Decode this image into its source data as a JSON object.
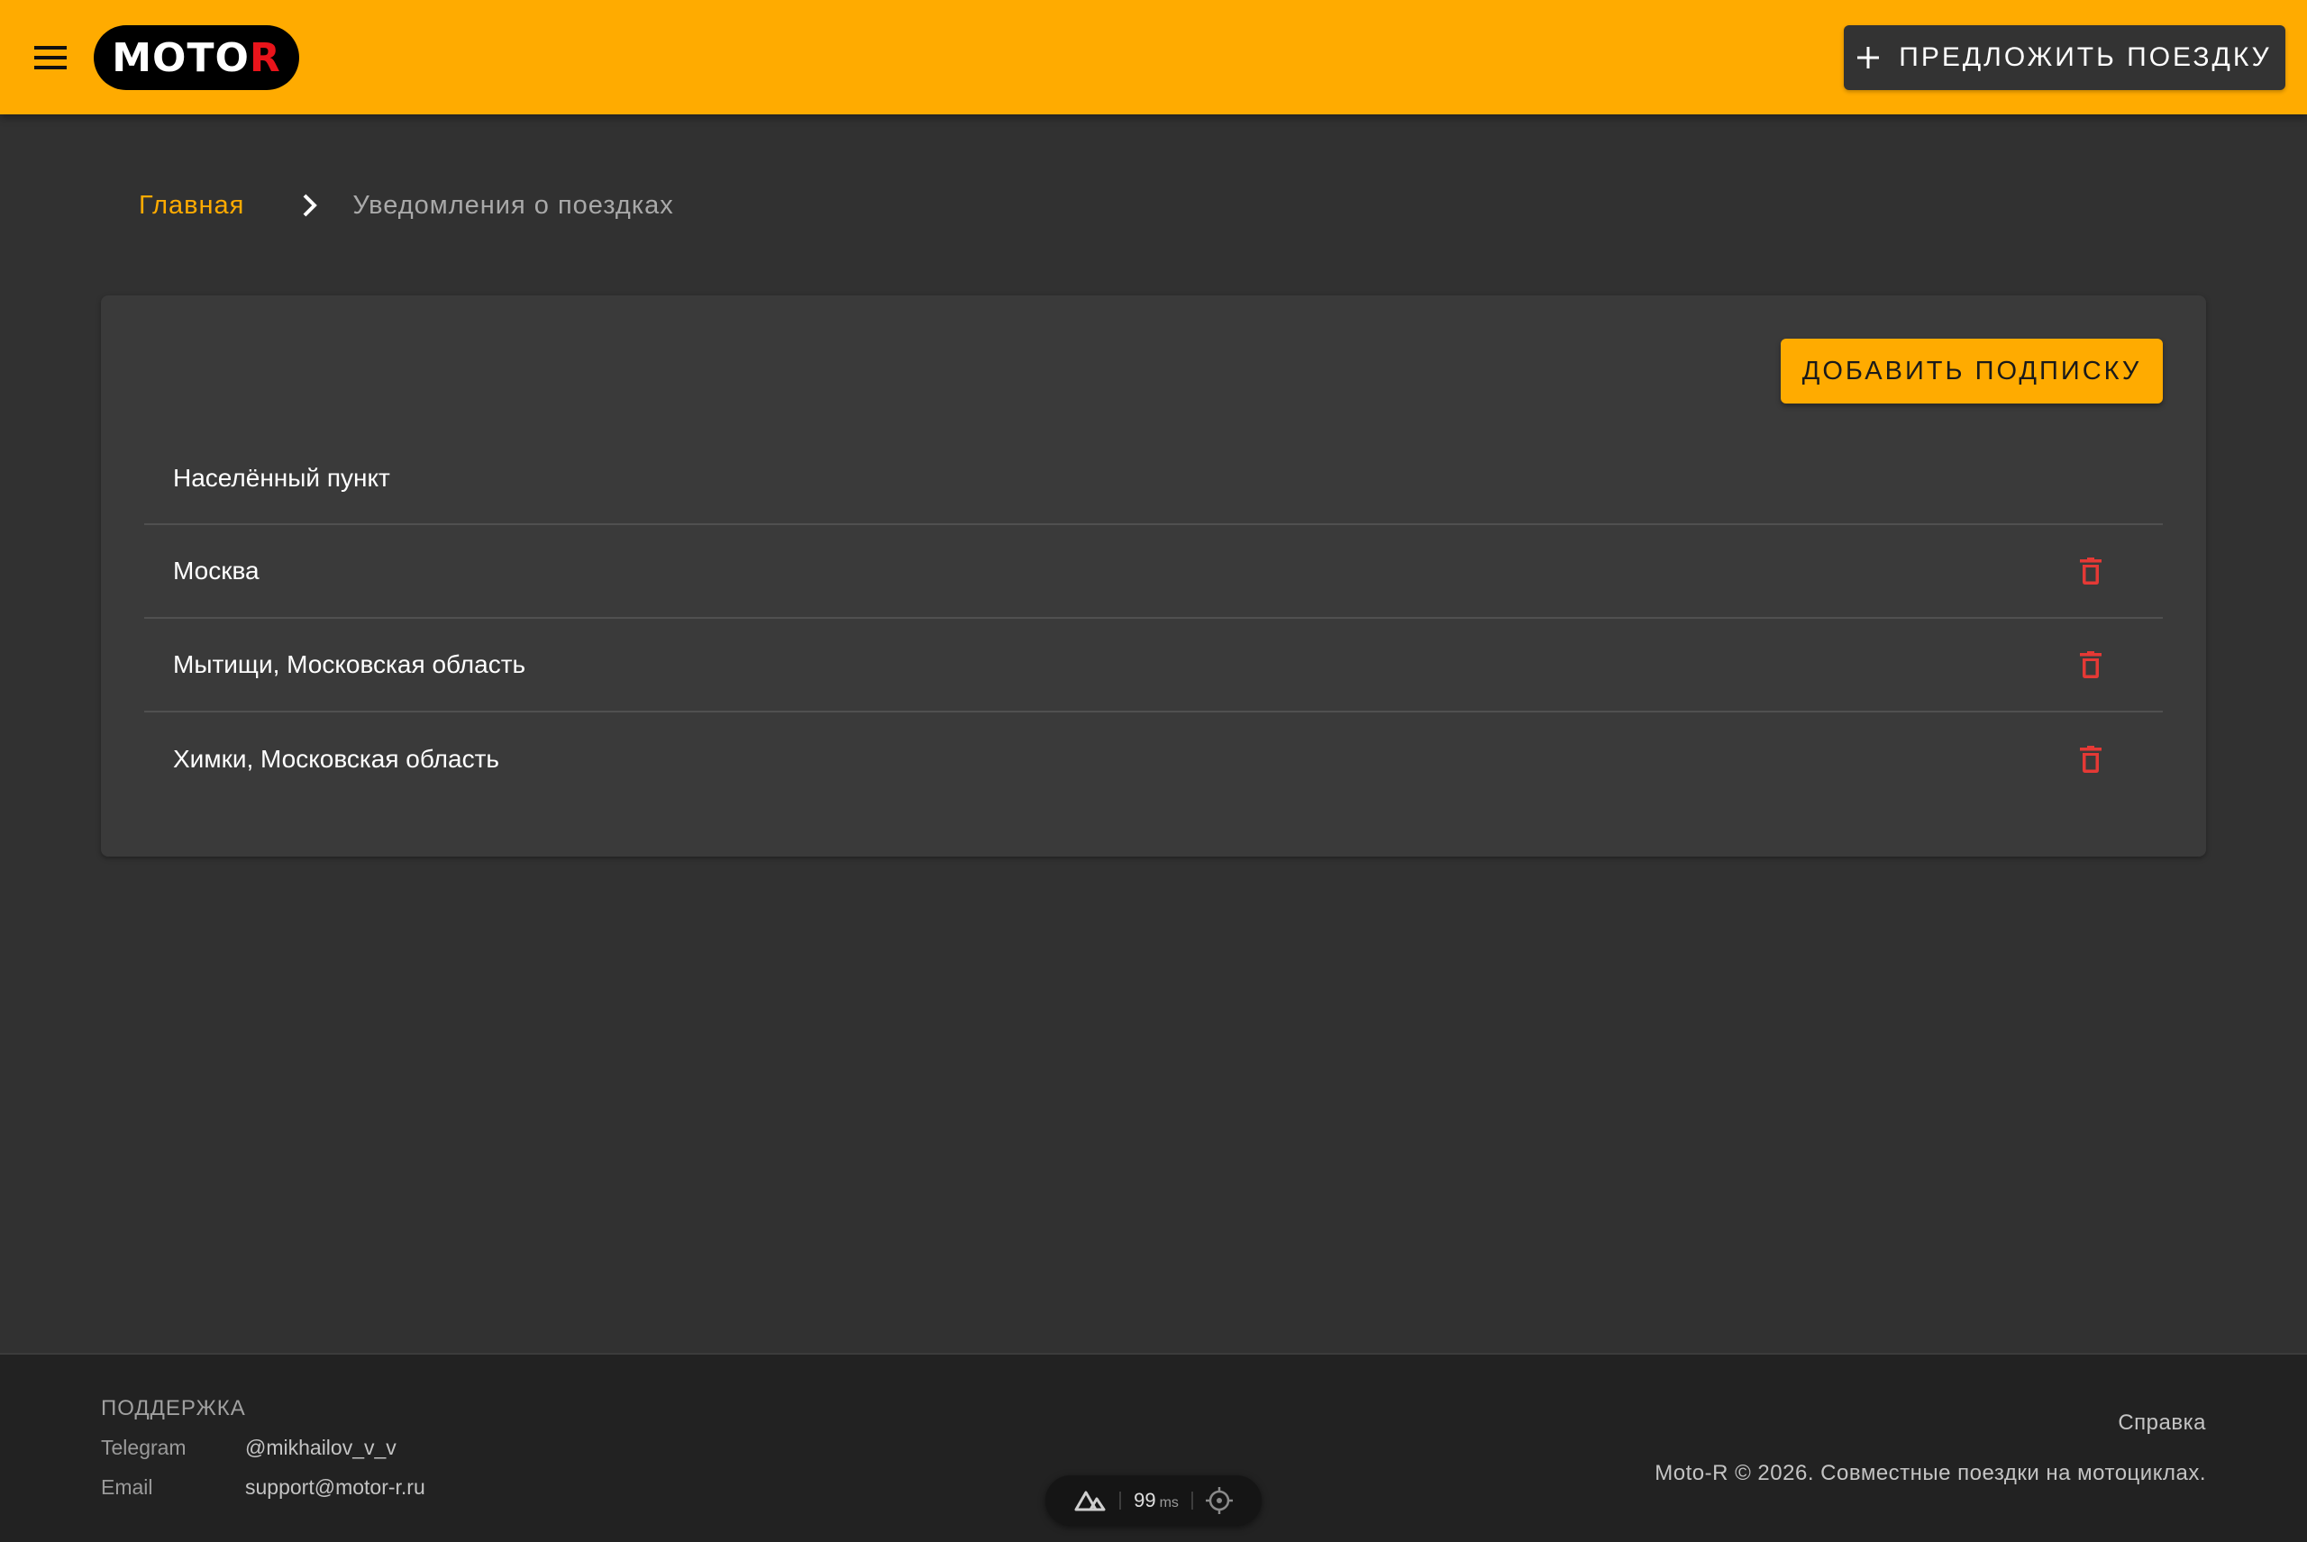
{
  "header": {
    "logo_main": "MOTO",
    "logo_accent": "R",
    "suggest_button_label": "ПРЕДЛОЖИТЬ ПОЕЗДКУ",
    "suggest_icon": "plus-icon",
    "menu_icon": "hamburger-menu-icon"
  },
  "breadcrumbs": {
    "home": "Главная",
    "current": "Уведомления о поездках",
    "separator_icon": "chevron-right-icon"
  },
  "card": {
    "add_subscription_label": "ДОБАВИТЬ ПОДПИСКУ",
    "column_header": "Населённый пункт",
    "rows": [
      {
        "city": "Москва"
      },
      {
        "city": "Мытищи, Московская область"
      },
      {
        "city": "Химки, Московская область"
      }
    ],
    "delete_icon": "trash-icon"
  },
  "footer": {
    "support_title": "ПОДДЕРЖКА",
    "telegram_label": "Telegram",
    "telegram_value": "@mikhailov_v_v",
    "email_label": "Email",
    "email_value": "support@motor-r.ru",
    "help_link": "Справка",
    "copyright": "Moto-R © 2026. Совместные поездки на мотоциклах."
  },
  "devtools": {
    "value": "99",
    "unit": "ms"
  },
  "colors": {
    "accent": "#ffab00",
    "background": "#313131",
    "card": "#3a3a3a",
    "footer": "#222222",
    "delete": "#e53935",
    "logo_accent": "#e8141b"
  }
}
